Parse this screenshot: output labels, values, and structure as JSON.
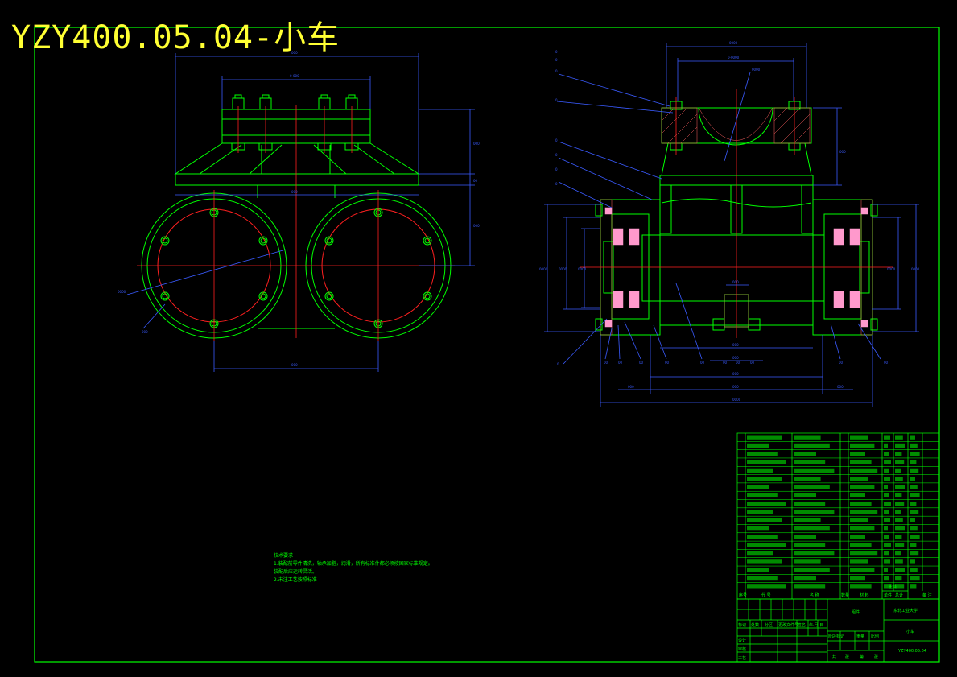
{
  "drawing": {
    "title": "YZY400.05.04-小车",
    "colors": {
      "background": "#000000",
      "part": "#00ff00",
      "dimension": "#3a5bff",
      "centerline": "#ff2020",
      "hatch": "#ff6060",
      "bearing": "#ff99cc",
      "title": "#ffff33",
      "frame": "#00ff00"
    }
  },
  "notes": {
    "heading": "技术要求",
    "lines": [
      "1.装配前零件清洗，轴承加脂，润滑，所有标准件都必须按国家标准规定。",
      "  装配后应运转灵活。",
      "2.未注工艺按照标准"
    ]
  },
  "title_block": {
    "company": "东北工业大学",
    "drawing_name": "小车",
    "drawing_no": "YZY400.05.04",
    "material": "组件",
    "headers": [
      "序号",
      "代 号",
      "名 称",
      "数量",
      "材 料",
      "单件",
      "总计",
      "备 注"
    ],
    "weight_header": "重量",
    "sign_labels": [
      "标记",
      "处数",
      "分区",
      "更改文件号",
      "签名",
      "年.月.日"
    ],
    "role_labels": [
      "设计",
      "审核",
      "工艺"
    ],
    "stage_labels": [
      "阶段标记",
      "重量",
      "比例"
    ],
    "sheet_labels": [
      "共",
      "张",
      "第",
      "张"
    ]
  }
}
